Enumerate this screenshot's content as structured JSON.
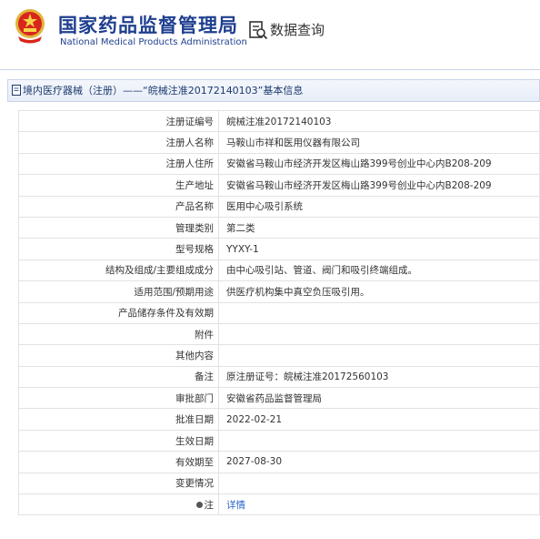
{
  "header": {
    "title_cn": "国家药品监督管理局",
    "title_en": "National Medical Products Administration",
    "query_label": "数据查询",
    "emblem_icon": "national-emblem-icon",
    "query_icon": "search-document-icon",
    "brand_color": "#1f3f8f"
  },
  "breadcrumb": {
    "text": "境内医疗器械（注册）——“皖械注准20172140103”基本信息",
    "icon": "document-icon"
  },
  "fields": [
    {
      "label": "注册证编号",
      "value": "皖械注准20172140103"
    },
    {
      "label": "注册人名称",
      "value": "马鞍山市祥和医用仪器有限公司"
    },
    {
      "label": "注册人住所",
      "value": "安徽省马鞍山市经济开发区梅山路399号创业中心内B208-209"
    },
    {
      "label": "生产地址",
      "value": "安徽省马鞍山市经济开发区梅山路399号创业中心内B208-209"
    },
    {
      "label": "产品名称",
      "value": "医用中心吸引系统"
    },
    {
      "label": "管理类别",
      "value": "第二类"
    },
    {
      "label": "型号规格",
      "value": "YYXY-1"
    },
    {
      "label": "结构及组成/主要组成成分",
      "value": "由中心吸引站、管道、阀门和吸引终端组成。"
    },
    {
      "label": "适用范围/预期用途",
      "value": "供医疗机构集中真空负压吸引用。"
    },
    {
      "label": "产品储存条件及有效期",
      "value": ""
    },
    {
      "label": "附件",
      "value": ""
    },
    {
      "label": "其他内容",
      "value": ""
    },
    {
      "label": "备注",
      "value": "原注册证号：皖械注准20172560103"
    },
    {
      "label": "审批部门",
      "value": "安徽省药品监督管理局"
    },
    {
      "label": "批准日期",
      "value": "2022-02-21"
    },
    {
      "label": "生效日期",
      "value": ""
    },
    {
      "label": "有效期至",
      "value": "2027-08-30"
    },
    {
      "label": "变更情况",
      "value": ""
    }
  ],
  "note_row": {
    "label": "注",
    "link": "详情",
    "icon": "lightbulb-icon"
  }
}
